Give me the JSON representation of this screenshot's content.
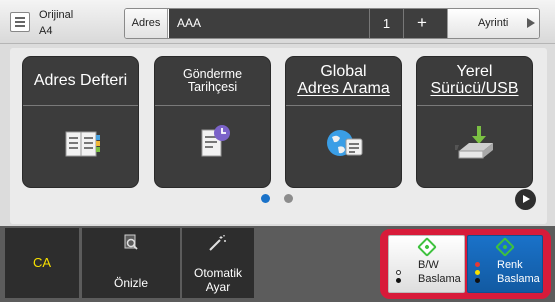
{
  "header": {
    "original_label": "Orijinal",
    "original_size": "A4",
    "address_label": "Adres",
    "address_value": "AAA",
    "address_count": "1",
    "add_symbol": "+",
    "detail_label": "Ayrinti"
  },
  "tiles": [
    {
      "label_lines": [
        "Adres Defteri"
      ],
      "icon": "address-book-icon"
    },
    {
      "label_lines": [
        "Gönderme Tarihçesi"
      ],
      "icon": "send-history-icon"
    },
    {
      "label_lines": [
        "Global",
        "Adres Arama"
      ],
      "icon": "global-address-search-icon"
    },
    {
      "label_lines": [
        "Yerel",
        "Sürücü/USB"
      ],
      "icon": "local-drive-usb-icon"
    }
  ],
  "pager": {
    "current": 1,
    "total": 2
  },
  "bottom": {
    "ca_label": "CA",
    "preview_label": "Önizle",
    "auto_set_label_1": "Otomatik",
    "auto_set_label_2": "Ayar",
    "bw_start_label_1": "B/W",
    "bw_start_label_2": "Baslama",
    "color_start_label_1": "Renk",
    "color_start_label_2": "Baslama"
  },
  "colors": {
    "accent_blue": "#1a72c9",
    "highlight_red": "#d81b3a",
    "start_green": "#3ec23e",
    "ca_yellow": "#f7e000"
  }
}
